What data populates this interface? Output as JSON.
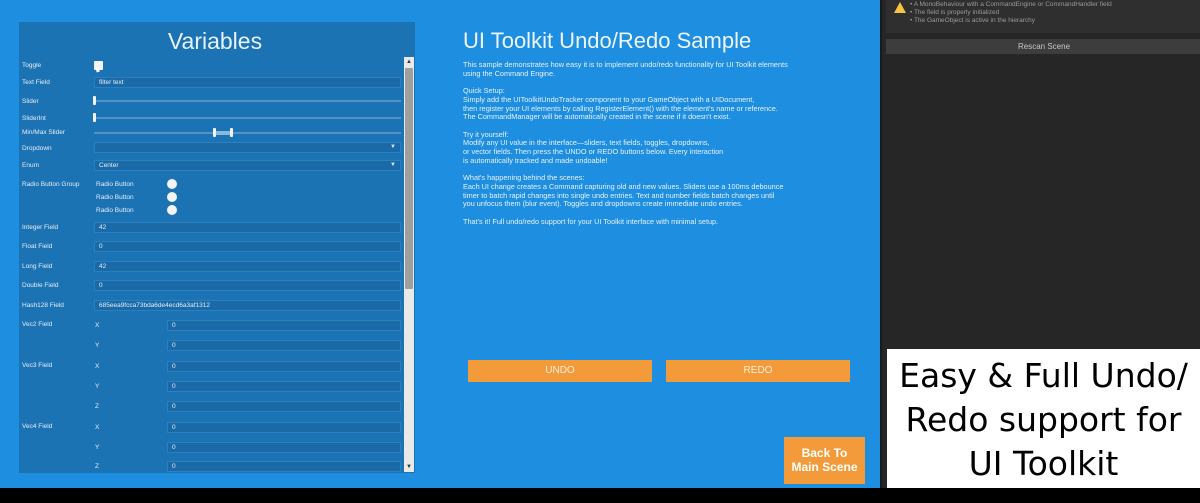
{
  "variables": {
    "title": "Variables",
    "toggle_label": "Toggle",
    "text_field_label": "Text Field",
    "text_field_value": "filter text",
    "slider_label": "Slider",
    "sliderint_label": "SliderInt",
    "minmax_label": "Min/Max Slider",
    "dropdown_label": "Dropdown",
    "enum_label": "Enum",
    "enum_value": "Center",
    "radio_group_label": "Radio Button Group",
    "radio_1": "Radio Button",
    "radio_2": "Radio Button",
    "radio_3": "Radio Button",
    "integer_label": "Integer Field",
    "integer_value": "42",
    "float_label": "Float Field",
    "float_value": "0",
    "long_label": "Long Field",
    "long_value": "42",
    "double_label": "Double Field",
    "double_value": "0",
    "hash_label": "Hash128 Field",
    "hash_value": "685eea9fcca73bda6de4ecd6a3af1312",
    "vec2_label": "Vec2 Field",
    "vec3_label": "Vec3 Field",
    "vec4_label": "Vec4 Field",
    "axis_x": "X",
    "axis_y": "Y",
    "axis_z": "Z",
    "vec_value": "0"
  },
  "sample": {
    "title": "UI Toolkit Undo/Redo Sample",
    "intro_1": "This sample demonstrates how easy it is to implement undo/redo functionality for UI Toolkit elements",
    "intro_2": "using the Command Engine.",
    "setup_head": "Quick Setup:",
    "setup_1": "Simply add the UIToolkitUndoTracker component to your GameObject with a UIDocument,",
    "setup_2": "then register your UI elements by calling RegisterElement() with the element's name or reference.",
    "setup_3": "The CommandManager will be automatically created in the scene if it doesn't exist.",
    "try_head": "Try it yourself:",
    "try_1": "Modify any UI value in the interface—sliders, text fields, toggles, dropdowns,",
    "try_2": "or vector fields. Then press the UNDO or REDO buttons below. Every interaction",
    "try_3": "is automatically tracked and made undoable!",
    "behind_head": "What's happening behind the scenes:",
    "behind_1": "Each UI change creates a Command capturing old and new values. Sliders use a 100ms debounce",
    "behind_2": "timer to batch rapid changes into single undo entries. Text and number fields batch changes until",
    "behind_3": "you unfocus them (blur event). Toggles and dropdowns create immediate undo entries.",
    "footer": "That's it! Full undo/redo support for your UI Toolkit interface with minimal setup.",
    "undo_label": "UNDO",
    "redo_label": "REDO",
    "back_line_1": "Back To",
    "back_line_2": "Main Scene"
  },
  "editor": {
    "warn_1": "• A MonoBehaviour with a CommandEngine or CommandHandler field",
    "warn_2": "• The field is properly initialized",
    "warn_3": "• The GameObject is active in the hierarchy",
    "rescan_label": "Rescan Scene"
  },
  "caption": {
    "line_1": "Easy & Full Undo/",
    "line_2": "Redo support for",
    "line_3": "UI Toolkit"
  },
  "colors": {
    "background_blue": "#1e8ee0",
    "panel_blue": "#1c73b4",
    "button_orange": "#f39a3a",
    "editor_dark": "#262626"
  }
}
